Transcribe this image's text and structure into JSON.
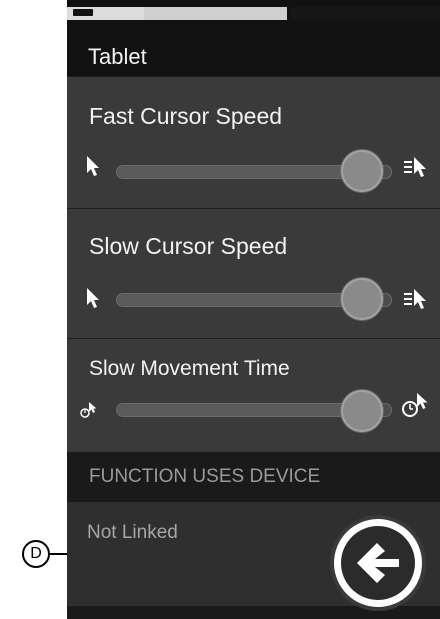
{
  "header": {
    "title": "Tablet"
  },
  "settings": [
    {
      "label": "Fast Cursor Speed",
      "value_fraction": 0.9,
      "left_icon": "cursor-arrow-icon",
      "right_icon": "fast-cursor-icon"
    },
    {
      "label": "Slow Cursor Speed",
      "value_fraction": 0.9,
      "left_icon": "cursor-arrow-icon",
      "right_icon": "fast-cursor-icon"
    },
    {
      "label": "Slow Movement Time",
      "value_fraction": 0.9,
      "left_icon": "timer-cursor-small-icon",
      "right_icon": "timer-cursor-large-icon"
    }
  ],
  "function_section": {
    "header": "FUNCTION USES DEVICE",
    "status": "Not Linked"
  },
  "back_button": {
    "icon": "back-arrow-icon"
  },
  "callout": {
    "label": "D"
  },
  "colors": {
    "background": "#2a2a2a",
    "panel": "#3a3a3a",
    "header": "#121212",
    "text": "#f2f2f2",
    "muted_text": "#a6a6a6"
  }
}
